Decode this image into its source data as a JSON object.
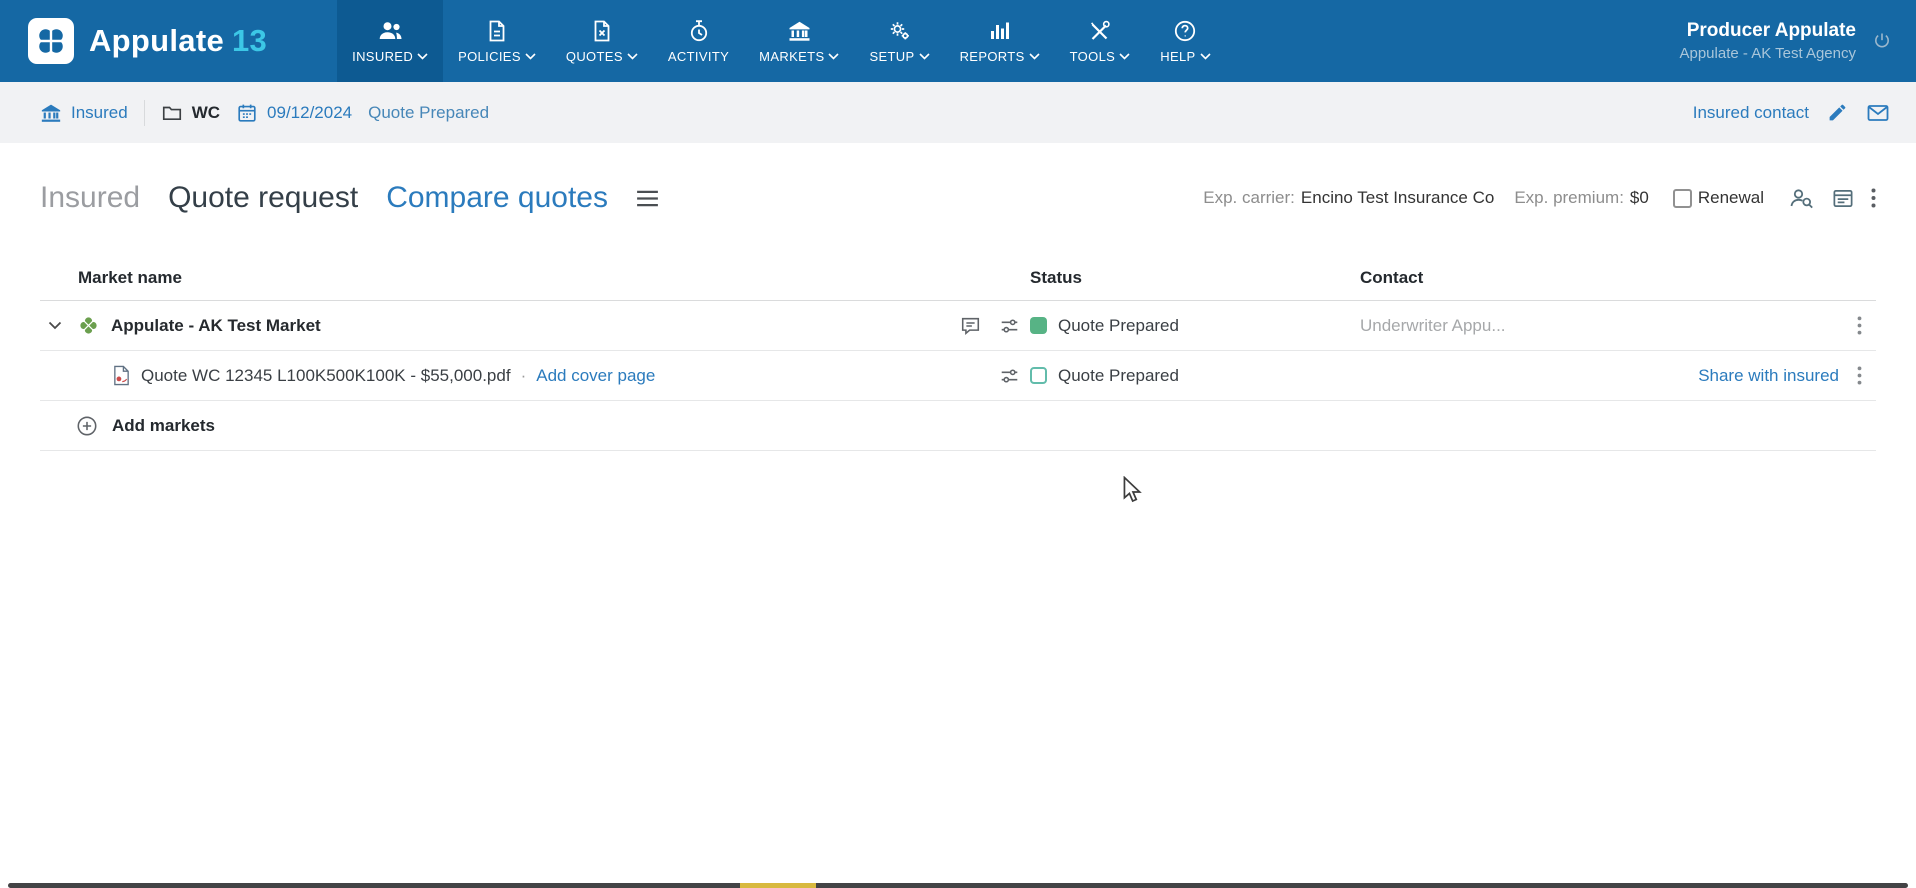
{
  "topnav": {
    "brand": {
      "name": "Appulate",
      "version": "13"
    },
    "items": [
      {
        "label": "INSURED"
      },
      {
        "label": "POLICIES"
      },
      {
        "label": "QUOTES"
      },
      {
        "label": "ACTIVITY"
      },
      {
        "label": "MARKETS"
      },
      {
        "label": "SETUP"
      },
      {
        "label": "REPORTS"
      },
      {
        "label": "TOOLS"
      },
      {
        "label": "HELP"
      }
    ],
    "user": {
      "name": "Producer Appulate",
      "agency": "Appulate - AK Test Agency"
    }
  },
  "breadcrumb": {
    "insured": "Insured",
    "lob": "WC",
    "effective_date": "09/12/2024",
    "status": "Quote Prepared",
    "contact_link": "Insured contact"
  },
  "tabs": {
    "insured": "Insured",
    "quote_request": "Quote request",
    "compare_quotes": "Compare quotes"
  },
  "meta": {
    "exp_carrier_label": "Exp. carrier:",
    "exp_carrier": "Encino Test Insurance Co",
    "exp_premium_label": "Exp. premium:",
    "exp_premium": "$0",
    "renewal": "Renewal"
  },
  "table": {
    "headers": {
      "market": "Market name",
      "status": "Status",
      "contact": "Contact"
    },
    "market_row": {
      "name": "Appulate - AK Test Market",
      "status": "Quote Prepared",
      "contact": "Underwriter Appu..."
    },
    "quote_row": {
      "file": "Quote WC 12345 L100K500K100K - $55,000.pdf",
      "separator": "·",
      "add_cover": "Add cover page",
      "status": "Quote Prepared",
      "share": "Share with insured"
    },
    "add_markets": "Add markets"
  },
  "colors": {
    "nav_blue": "#1568a4",
    "nav_active": "#0d5a92",
    "brand_cyan": "#3cc7e6",
    "link_blue": "#2b7bbd",
    "status_green": "#57b385",
    "status_teal_border": "#62bcab"
  }
}
